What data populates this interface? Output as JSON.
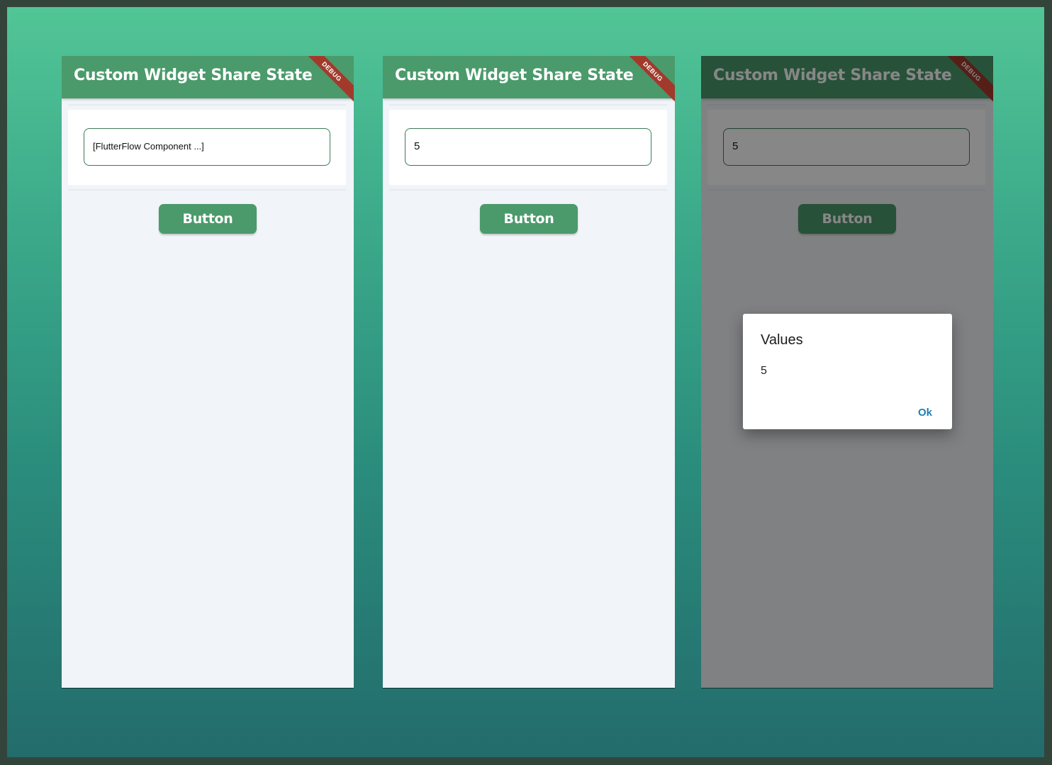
{
  "app": {
    "title": "Custom Widget Share State",
    "debug_banner": "DEBUG",
    "theme_color": "#4b9a6b"
  },
  "screens": [
    {
      "input_value": "[FlutterFlow Component ...]",
      "button_label": "Button"
    },
    {
      "input_value": "5",
      "button_label": "Button"
    },
    {
      "input_value": "5",
      "button_label": "Button"
    }
  ],
  "dialog": {
    "title": "Values",
    "body": "5",
    "ok_label": "Ok"
  }
}
